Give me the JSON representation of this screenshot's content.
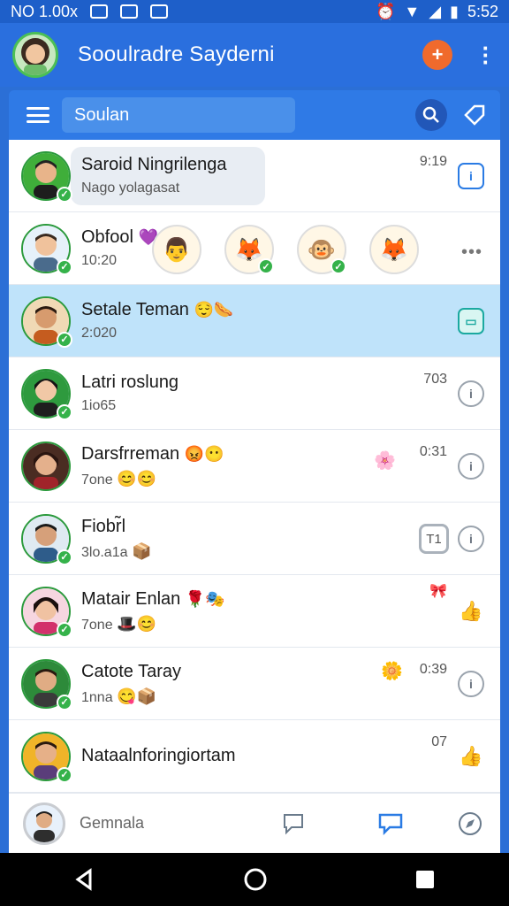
{
  "status_bar": {
    "left_text": "NO 1.00x",
    "time": "5:52"
  },
  "app_bar": {
    "title": "Sooulradre Sayderni",
    "action_icon": "new-chat-icon",
    "menu_icon": "more-vert-icon"
  },
  "search": {
    "placeholder": "Soulan",
    "menu_icon": "hamburger-icon",
    "search_icon": "search-icon",
    "tag_icon": "tag-icon"
  },
  "chats": [
    {
      "name": "Saroid Ningrilenga",
      "sub": "Nago yolagasat",
      "time": "9:19",
      "icon": "info-icon"
    },
    {
      "name": "Obfool",
      "name_emoji": "💜",
      "sub": "10:20",
      "time": "",
      "icon": "more-dots-icon",
      "stories": [
        "👨",
        "🦊",
        "🐵",
        "🦊"
      ]
    },
    {
      "name": "Setale Teman",
      "name_emoji": "😌🌭",
      "sub": "2:020",
      "time": "",
      "icon": "message-icon"
    },
    {
      "name": "Latri roslung",
      "sub": "1io65",
      "time": "703",
      "icon": "info-icon"
    },
    {
      "name": "Darsfrreman",
      "name_emoji": "😡😶",
      "sub": "7one",
      "sub_emoji": "😊😊",
      "time": "0:31",
      "icon": "info-icon",
      "badge": "🌸"
    },
    {
      "name": "Fiobr̃l",
      "sub": "3lo.a1a",
      "sub_emoji": "📦",
      "time": "",
      "icon": "info-icon",
      "square_badge": "T1"
    },
    {
      "name": "Matair Enlan",
      "name_emoji": "🌹🎭",
      "sub": "7one",
      "sub_emoji": "🎩😊",
      "time": "",
      "icon": "like-icon",
      "badge": "🎀"
    },
    {
      "name": "Catote Taray",
      "sub": "1nna",
      "sub_emoji": "😋📦",
      "time": "0:39",
      "icon": "info-icon",
      "badge": "🌼"
    },
    {
      "name": "Nataalnforingiortam",
      "sub": "",
      "time": "07",
      "icon": "like-icon"
    }
  ],
  "bottom_bar": {
    "label": "Gemnala"
  },
  "nav": {
    "back": "back-icon",
    "home": "home-icon",
    "recents": "recents-icon"
  }
}
